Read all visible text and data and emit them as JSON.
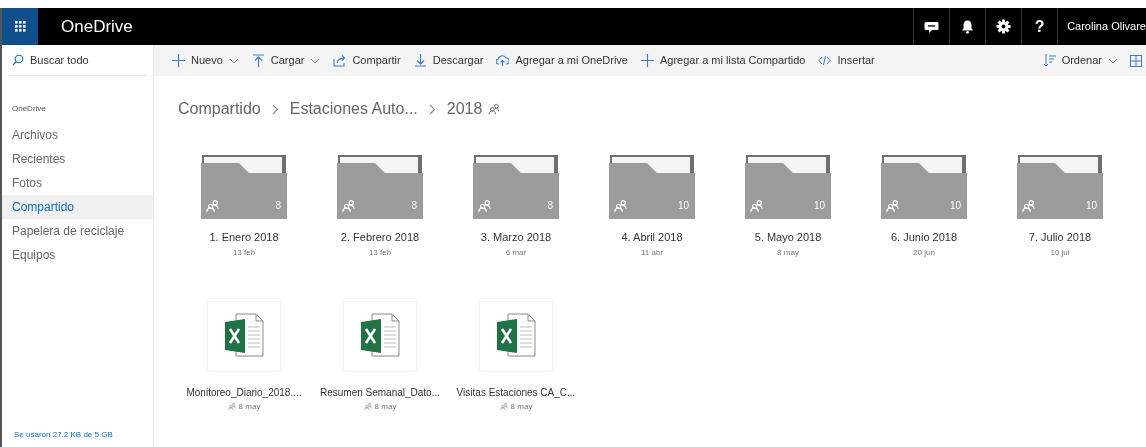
{
  "app": {
    "title": "OneDrive",
    "user": "Carolina Olivare"
  },
  "header_buttons": [
    {
      "kind": "chat"
    },
    {
      "kind": "bell"
    },
    {
      "kind": "gear"
    },
    {
      "kind": "help",
      "label": "?"
    }
  ],
  "search": {
    "placeholder": "Buscar todo"
  },
  "toolbar": [
    {
      "kind": "plus",
      "label": "Nuevo",
      "dropdown": true
    },
    {
      "kind": "upload",
      "label": "Cargar",
      "dropdown": true
    },
    {
      "kind": "share",
      "label": "Compartir",
      "dropdown": false
    },
    {
      "kind": "download",
      "label": "Descargar",
      "dropdown": false
    },
    {
      "kind": "cloud",
      "label": "Agregar a mi OneDrive",
      "dropdown": false
    },
    {
      "kind": "plus",
      "label": "Agregar a mi lista Compartido",
      "dropdown": false
    },
    {
      "kind": "embed",
      "label": "Insertar",
      "dropdown": false
    }
  ],
  "sort": {
    "label": "Ordenar",
    "dropdown": true
  },
  "sidebar": {
    "heading": "OneDrive",
    "items": [
      {
        "label": "Archivos",
        "selected": false
      },
      {
        "label": "Recientes",
        "selected": false
      },
      {
        "label": "Fotos",
        "selected": false
      },
      {
        "label": "Compartido",
        "selected": true
      },
      {
        "label": "Papelera de reciclaje",
        "selected": false
      },
      {
        "label": "Equipos",
        "selected": false
      }
    ],
    "storage": "Se usaron 27.2 KB de 5 GB"
  },
  "breadcrumb": {
    "items": [
      "Compartido",
      "Estaciones Auto...",
      "2018"
    ],
    "shared": true
  },
  "folders": [
    {
      "name": "1. Enero 2018",
      "date": "13 feb",
      "count": "8",
      "shared": true
    },
    {
      "name": "2. Febrero 2018",
      "date": "13 feb",
      "count": "8",
      "shared": true
    },
    {
      "name": "3. Marzo 2018",
      "date": "6 mar",
      "count": "8",
      "shared": true
    },
    {
      "name": "4. Abril 2018",
      "date": "11 abr",
      "count": "10",
      "shared": true
    },
    {
      "name": "5. Mayo 2018",
      "date": "8 may",
      "count": "10",
      "shared": true
    },
    {
      "name": "6. Junio 2018",
      "date": "20 jun",
      "count": "10",
      "shared": true
    },
    {
      "name": "7. Julio 2018",
      "date": "10 jul",
      "count": "10",
      "shared": true
    }
  ],
  "files": [
    {
      "name": "Monitoreo_Diario_2018....",
      "date": "8 may",
      "shared": true
    },
    {
      "name": "Resumen Semanal_Dato...",
      "date": "8 may",
      "shared": true
    },
    {
      "name": "Visitas Estaciones CA_C...",
      "date": "8 may",
      "shared": true
    }
  ]
}
